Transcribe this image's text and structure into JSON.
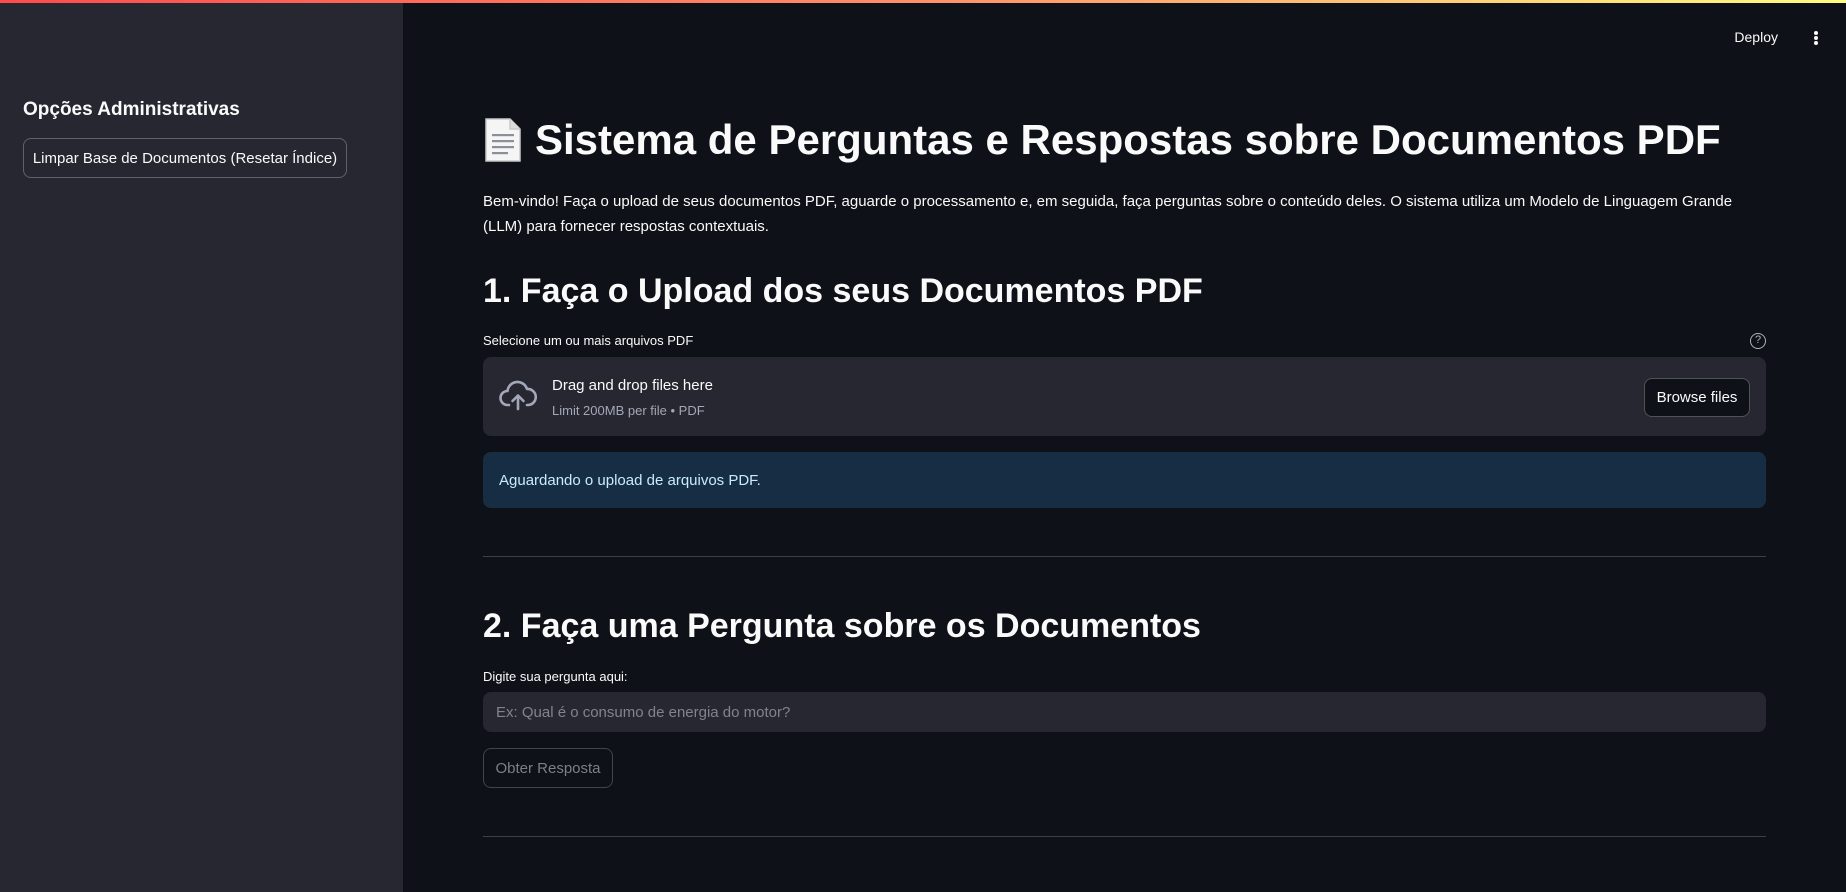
{
  "sidebar": {
    "header": "Opções Administrativas",
    "reset_button_label": "Limpar Base de Documentos (Resetar Índice)"
  },
  "toolbar": {
    "deploy_label": "Deploy",
    "menu_icon": "vertical-dots-icon"
  },
  "main": {
    "title_icon": "document-icon",
    "title": "Sistema de Perguntas e Respostas sobre Documentos PDF",
    "intro": "Bem-vindo! Faça o upload de seus documentos PDF, aguarde o processamento e, em seguida, faça perguntas sobre o conteúdo deles. O sistema utiliza um Modelo de Linguagem Grande (LLM) para fornecer respostas contextuais.",
    "upload_section": {
      "title": "1. Faça o Upload dos seus Documentos PDF",
      "label": "Selecione um ou mais arquivos PDF",
      "help_icon": "question-circle-icon",
      "dropzone_icon": "cloud-upload-icon",
      "dropzone_title": "Drag and drop files here",
      "dropzone_subtitle": "Limit 200MB per file • PDF",
      "browse_label": "Browse files",
      "info_message": "Aguardando o upload de arquivos PDF."
    },
    "question_section": {
      "title": "2. Faça uma Pergunta sobre os Documentos",
      "label": "Digite sua pergunta aqui:",
      "input_value": "",
      "input_placeholder": "Ex: Qual é o consumo de energia do motor?",
      "submit_label": "Obter Resposta"
    }
  },
  "colors": {
    "background": "#0e1117",
    "sidebar": "#262730",
    "info_background": "#172d43",
    "info_text": "#c7ebff",
    "accent_red": "#ff4b4b"
  }
}
